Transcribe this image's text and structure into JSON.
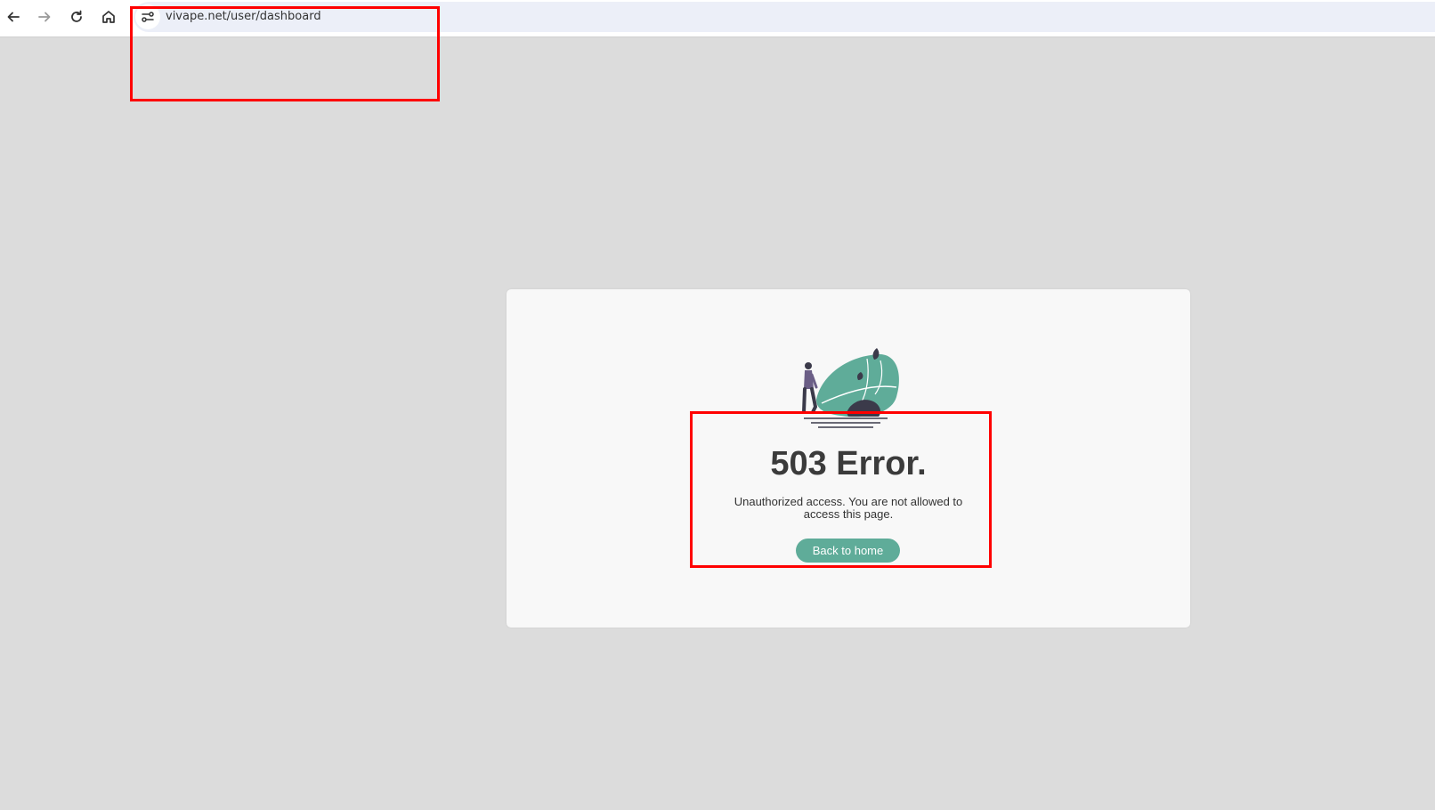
{
  "browser": {
    "url": "vivape.net/user/dashboard",
    "icons": [
      "back-arrow-icon",
      "forward-arrow-icon",
      "reload-icon",
      "home-icon",
      "site-info-icon"
    ]
  },
  "error_page": {
    "title": "503 Error.",
    "message": "Unauthorized access. You are not allowed to access this page.",
    "button_label": "Back to home"
  },
  "colors": {
    "page_background": "#dcdcdc",
    "card_background": "#f8f8f8",
    "accent": "#5fac99",
    "annotation": "#ff0000",
    "title_text": "#3b3b3b"
  }
}
